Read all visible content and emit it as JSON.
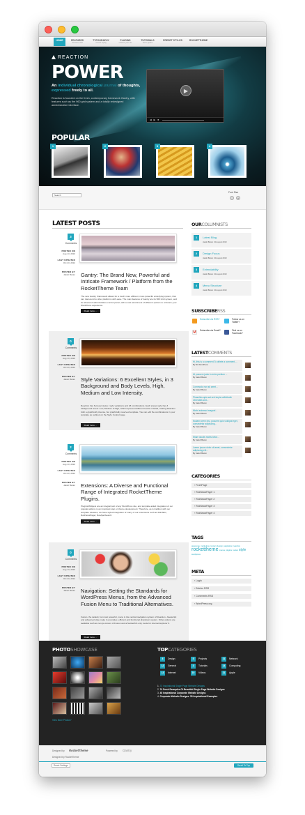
{
  "nav": {
    "items": [
      {
        "label": "Home",
        "sub": ""
      },
      {
        "label": "Features",
        "sub": "awesome stuff"
      },
      {
        "label": "Typography",
        "sub": "content styling"
      },
      {
        "label": "Plugins",
        "sub": "enhance your site"
      },
      {
        "label": "Tutorials",
        "sub": "theme guides"
      },
      {
        "label": "Preset Styles",
        "sub": ""
      },
      {
        "label": "RocketTheme",
        "sub": ""
      }
    ]
  },
  "hero": {
    "brand": "REACTION",
    "title": "POWER",
    "tagline_a": "An ",
    "tagline_b": "individual chronological",
    "tagline_c": " journal",
    "tagline_d": " of thoughts, ",
    "tagline_e": "expressed",
    "tagline_f": " freely to all.",
    "description": "Reaction is founded on the fresh, contemporary framework Gantry, with features such as the 960 grid system and a totally redesigned administrative interface.",
    "video_controls": "◀ ▶ ■"
  },
  "popular": {
    "title": "POPULAR",
    "items": [
      "1",
      "2",
      "3",
      "4"
    ]
  },
  "toolbar": {
    "search_placeholder": "Search",
    "font_size_label": "Font Size",
    "decrease": "-",
    "increase": "+"
  },
  "latest": {
    "title": "LATEST POSTS",
    "posts": [
      {
        "comments": "3",
        "comments_label": "Comments",
        "posted_label": "POSTED ON",
        "posted": "Aug 13, 2010",
        "updated_label": "LAST UPDATED",
        "updated": "Oct 23, 2012",
        "by_label": "POSTED BY",
        "author": "Jakub Baran",
        "title": "Gantry: The Brand New, Powerful and Intricate Framework / Platform from the RocketTheme Team",
        "excerpt": "The new Gantry Framework allows for a much more efficient, more powerful underlying system, that can transcend to other platforms with ease. The main features of Gantry are its 960 Grid system, and its advanced administrative control panel, with a vast assortment of different options to enhance your WordPress experience.",
        "read_more": "Read more ..."
      },
      {
        "comments": "0",
        "comments_label": "Comments",
        "posted_label": "POSTED ON",
        "posted": "Aug 13, 2010",
        "updated_label": "LAST UPDATED",
        "updated": "Oct 23, 2012",
        "by_label": "POSTED BY",
        "author": "Jakub Baran",
        "title": "Style Variations: 6 Excellent Styles, in 3 Background and Body Levels, High, Medium and Low Intensity.",
        "excerpt": "Reaction has 6 preset styles / style variations and 18 combinations. Each preset style has 3 background levels: Low, Medium & High, which represent different levels of detail, making Reaction both a graphically intense, but graphically reserved template. You can edit the combinations in your template as outlined on the Style Control page.",
        "read_more": "Read more ..."
      },
      {
        "comments": "2",
        "comments_label": "Comments",
        "posted_label": "POSTED ON",
        "posted": "Aug 13, 2010",
        "updated_label": "LAST UPDATED",
        "updated": "Oct 23, 2012",
        "by_label": "POSTED BY",
        "author": "Jakub Baran",
        "title": "Extensions: A Diverse and Functional Range of Integrated RocketTheme Plugins.",
        "excerpt": "Plugins/Widgets are an integral part of any WordPress site, and template aided integration of our popular addons is an important step on theme development. Therefore, as is tradition with our template releases, we have styled integration of many of our extensions such as RokTabs, RokNewsPager, RokAjaxSearch",
        "read_more": "Read more ..."
      },
      {
        "comments": "0",
        "comments_label": "Comments",
        "posted_label": "POSTED ON",
        "posted": "Aug 13, 2010",
        "updated_label": "LAST UPDATED",
        "updated": "Oct 23, 2012",
        "by_label": "POSTED BY",
        "author": "Jakub Baran",
        "title": "Navigation: Setting the Standards for WordPress Menus, from the Advanced Fusion Menu to Traditional Alternatives.",
        "excerpt": "Fusion, the default, but most powerful, menu is the central navigation system of Reaction. Javascript and advanced style make it a complex, efficient and functional dropdown system. Other options are available such as non-js version of Fusion and a Suckerfish only mode for internet Explorer 6.",
        "read_more": "Read more ..."
      }
    ]
  },
  "columnists": {
    "title_a": "OUR",
    "title_b": "COLUMNISTS",
    "items": [
      {
        "num": "1",
        "title": "Latest Blog",
        "by": "Jakub Baran 13 August 2010"
      },
      {
        "num": "2",
        "title": "Design Focus",
        "by": "Jakub Baran 13 August 2010"
      },
      {
        "num": "3",
        "title": "Extendability",
        "by": "Jakub Baran 13 August 2010"
      },
      {
        "num": "4",
        "title": "Menu Structure",
        "by": "Jakub Baran 13 August 2010"
      }
    ]
  },
  "subscribe": {
    "title_a": "SUBSCRIBE",
    "title_b": "RSS",
    "rss": "Subscribe via RSS?",
    "twitter": "Follow us on Twitter?",
    "email": "Subscribe via Email?",
    "facebook": "Find us on Facebook?"
  },
  "comments": {
    "title_a": "LATEST",
    "title_b": "COMMENTS",
    "items": [
      {
        "text": "Hi, this is a comment.To delete a comment,...",
        "by": "By Mr WordPress"
      },
      {
        "text": "Ut posuere justo in enim pretium ...",
        "by": "By Jakub Baran"
      },
      {
        "text": "Commodo non sit amet...",
        "by": "By Jakub Baran"
      },
      {
        "text": "Phasellus quis sat sed turpis sollicitudin venenatis sed...",
        "by": "By Jakub Baran"
      },
      {
        "text": "Morbi euismod magna!...",
        "by": "By Jakub Baran"
      },
      {
        "text": "Nullam lorem nisi, posuere quis volutpat eget, consectetur adipiscing...",
        "by": "By Jakub Baran"
      },
      {
        "text": "Etiam iaculis mollis tortor...",
        "by": "By Jakub Baran"
      },
      {
        "text": "Lorem ipsum dolor sit amet, consectetur adipiscing elit...",
        "by": "By Jakub Baran"
      }
    ]
  },
  "categories": {
    "title": "CATEGORIES",
    "items": [
      "FrontPage",
      "RokNewsPager 1",
      "RokNewsPager 2",
      "RokNewsPager 3",
      "RokNewsPager 4"
    ]
  },
  "tags": {
    "title": "TAGS",
    "items": [
      "awesome",
      "marketing",
      "contact",
      "design",
      "pagination",
      "reaction",
      "rockettheme",
      "menus",
      "plugins",
      "rocket",
      "style",
      "wordpress"
    ]
  },
  "meta": {
    "title": "META",
    "items": [
      "Login",
      "Entries RSS",
      "Comments RSS",
      "WordPress.org"
    ]
  },
  "footer": {
    "showcase_a": "PHOTO",
    "showcase_b": "SHOWCASE",
    "view_more": "View More Photos?",
    "topcat_a": "TOP",
    "topcat_b": "CATEGORIES",
    "cats": [
      {
        "num": "8",
        "label": "Design"
      },
      {
        "num": "5",
        "label": "Projects"
      },
      {
        "num": "21",
        "label": "Network"
      },
      {
        "num": "12",
        "label": "General"
      },
      {
        "num": "3",
        "label": "Tutorials"
      },
      {
        "num": "14",
        "label": "Computing"
      },
      {
        "num": "13",
        "label": "Internet"
      },
      {
        "num": "19",
        "label": "Videos"
      },
      {
        "num": "21",
        "label": "Apple"
      }
    ],
    "list": [
      {
        "n": "1.",
        "text": "73 Inspirational Single Page Website Designs",
        "hl": true
      },
      {
        "n": "2.",
        "text": "74 Fresh Examples Of Beautiful Single Page Website Designs",
        "hl": false
      },
      {
        "n": "3.",
        "text": "45 Inspirational Corporate Website Designs",
        "hl": false
      },
      {
        "n": "4.",
        "text": "Corporate Website Designs: 50 Inspirational Examples",
        "hl": false
      }
    ]
  },
  "bottom": {
    "designed_by": "Designed by",
    "rockettheme": "RocketTheme",
    "powered_by": "Powered by",
    "gantry": "Gantry",
    "credit": "Designed by RocketTheme",
    "reset": "Reset Settings",
    "scroll_top": "Scroll To Top"
  }
}
